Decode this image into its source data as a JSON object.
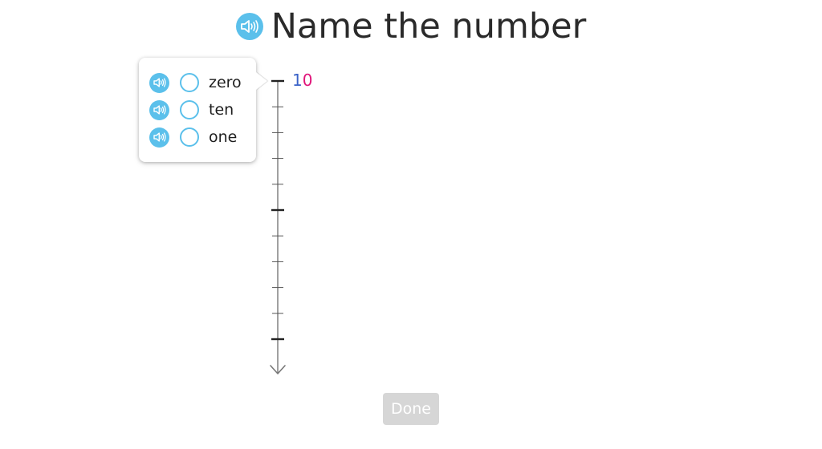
{
  "header": {
    "title": "Name the number",
    "speaker_icon": "speaker-icon"
  },
  "popup": {
    "options": [
      {
        "label": "zero"
      },
      {
        "label": "ten"
      },
      {
        "label": "one"
      }
    ]
  },
  "number_line": {
    "top_label_tens": "1",
    "top_label_ones": "0",
    "minor_ticks_between_major": 4,
    "major_tick_count": 3
  },
  "footer": {
    "done_label": "Done"
  },
  "colors": {
    "accent": "#5bc0eb",
    "tens_digit": "#3a63c8",
    "ones_digit": "#e0157a",
    "done_disabled": "#d6d6d6"
  }
}
